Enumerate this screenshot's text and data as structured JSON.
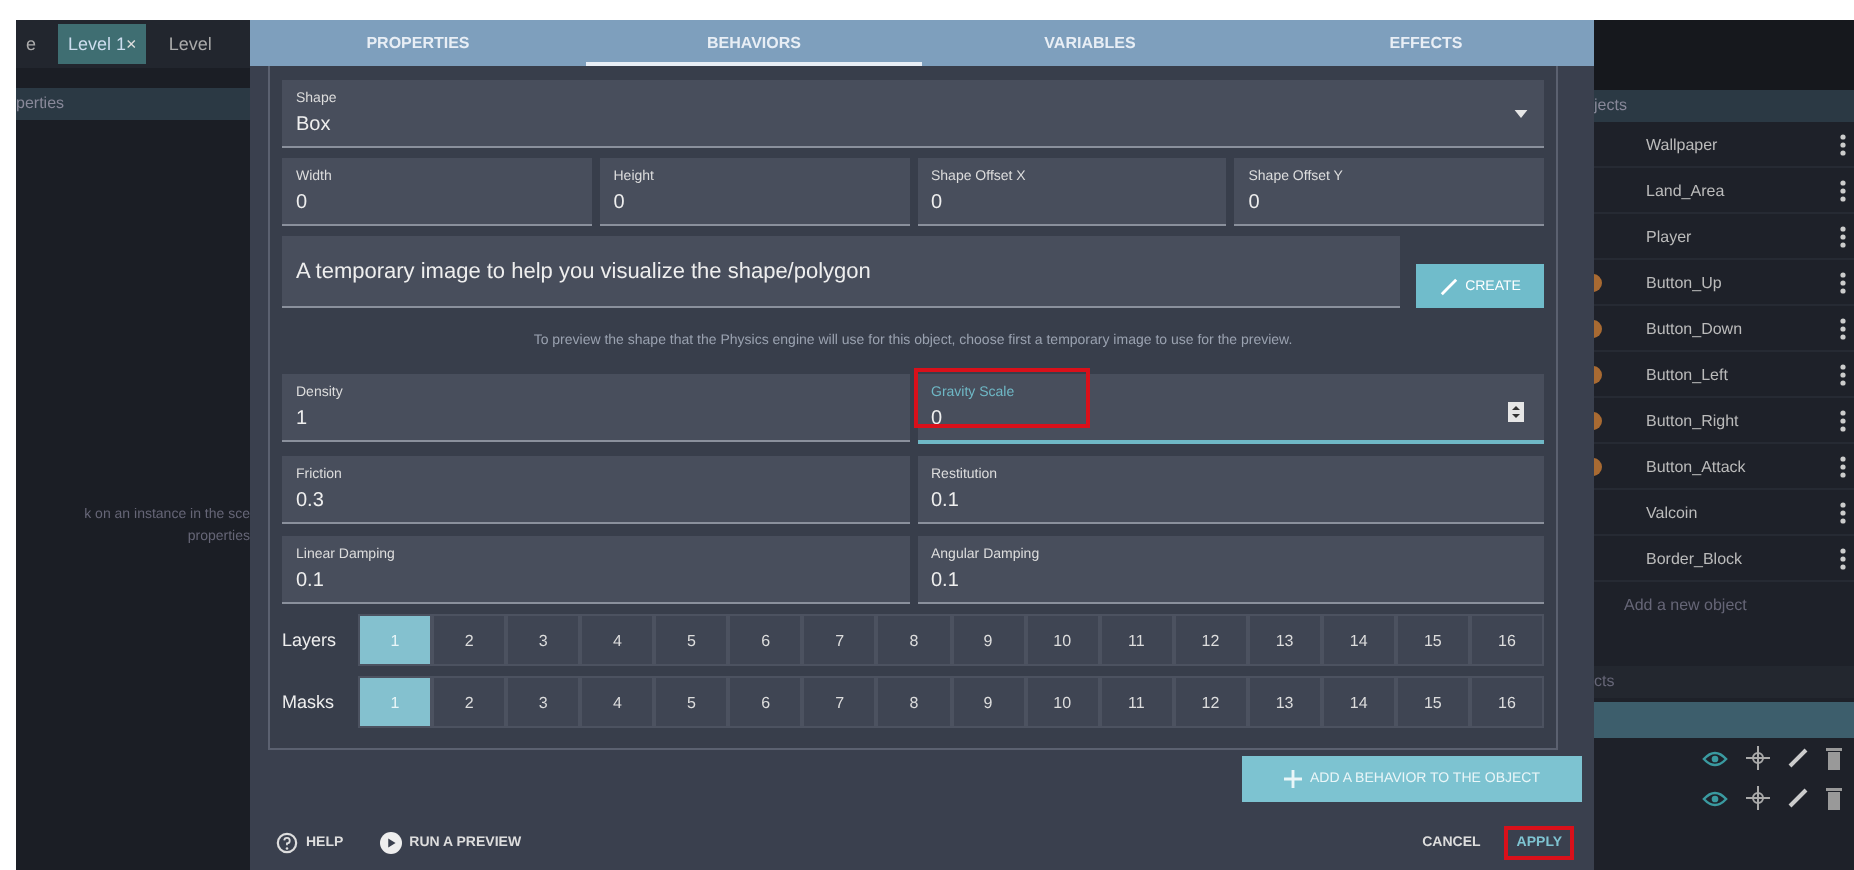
{
  "left_panel": {
    "tabs": [
      {
        "label": "e",
        "selected": false
      },
      {
        "label": "Level 1",
        "close": "×",
        "selected": true
      },
      {
        "label": "Level",
        "selected": false
      }
    ],
    "header": "perties",
    "hint": [
      "k on an instance in the sce",
      "properties"
    ]
  },
  "dialog": {
    "tabs": [
      {
        "label": "PROPERTIES",
        "selected": false
      },
      {
        "label": "BEHAVIORS",
        "selected": true
      },
      {
        "label": "VARIABLES",
        "selected": false
      },
      {
        "label": "EFFECTS",
        "selected": false
      }
    ],
    "shape": {
      "label": "Shape",
      "value": "Box"
    },
    "size_fields": [
      {
        "label": "Width",
        "value": "0"
      },
      {
        "label": "Height",
        "value": "0"
      },
      {
        "label": "Shape Offset X",
        "value": "0"
      },
      {
        "label": "Shape Offset Y",
        "value": "0"
      }
    ],
    "image_field": {
      "value": "A temporary image to help you visualize the shape/polygon"
    },
    "create_button": "CREATE",
    "preview_hint": "To preview the shape that the Physics engine will use for this object, choose first a temporary image to use for the preview.",
    "physics_fields": [
      {
        "label": "Density",
        "value": "1",
        "focused": false,
        "highlighted": false
      },
      {
        "label": "Gravity Scale",
        "value": "0",
        "focused": true,
        "highlighted": true
      },
      {
        "label": "Friction",
        "value": "0.3",
        "focused": false,
        "highlighted": false
      },
      {
        "label": "Restitution",
        "value": "0.1",
        "focused": false,
        "highlighted": false
      },
      {
        "label": "Linear Damping",
        "value": "0.1",
        "focused": false,
        "highlighted": false
      },
      {
        "label": "Angular Damping",
        "value": "0.1",
        "focused": false,
        "highlighted": false
      }
    ],
    "bit_rows": [
      {
        "label": "Layers",
        "bits": [
          {
            "label": "1",
            "selected": true
          },
          {
            "label": "2",
            "selected": false
          },
          {
            "label": "3",
            "selected": false
          },
          {
            "label": "4",
            "selected": false
          },
          {
            "label": "5",
            "selected": false
          },
          {
            "label": "6",
            "selected": false
          },
          {
            "label": "7",
            "selected": false
          },
          {
            "label": "8",
            "selected": false
          },
          {
            "label": "9",
            "selected": false
          },
          {
            "label": "10",
            "selected": false
          },
          {
            "label": "11",
            "selected": false
          },
          {
            "label": "12",
            "selected": false
          },
          {
            "label": "13",
            "selected": false
          },
          {
            "label": "14",
            "selected": false
          },
          {
            "label": "15",
            "selected": false
          },
          {
            "label": "16",
            "selected": false
          }
        ]
      },
      {
        "label": "Masks",
        "bits": [
          {
            "label": "1",
            "selected": true
          },
          {
            "label": "2",
            "selected": false
          },
          {
            "label": "3",
            "selected": false
          },
          {
            "label": "4",
            "selected": false
          },
          {
            "label": "5",
            "selected": false
          },
          {
            "label": "6",
            "selected": false
          },
          {
            "label": "7",
            "selected": false
          },
          {
            "label": "8",
            "selected": false
          },
          {
            "label": "9",
            "selected": false
          },
          {
            "label": "10",
            "selected": false
          },
          {
            "label": "11",
            "selected": false
          },
          {
            "label": "12",
            "selected": false
          },
          {
            "label": "13",
            "selected": false
          },
          {
            "label": "14",
            "selected": false
          },
          {
            "label": "15",
            "selected": false
          },
          {
            "label": "16",
            "selected": false
          }
        ]
      }
    ],
    "add_behavior_button": "ADD A BEHAVIOR TO THE OBJECT",
    "footer": {
      "help": "HELP",
      "preview": "RUN A PREVIEW",
      "cancel": "CANCEL",
      "apply": {
        "label": "APPLY",
        "highlighted": true
      }
    }
  },
  "right_panel": {
    "header": "jects",
    "objects": [
      {
        "name": "Wallpaper",
        "thumbnail": false
      },
      {
        "name": "Land_Area",
        "thumbnail": false
      },
      {
        "name": "Player",
        "thumbnail": false
      },
      {
        "name": "Button_Up",
        "thumbnail": true
      },
      {
        "name": "Button_Down",
        "thumbnail": true
      },
      {
        "name": "Button_Left",
        "thumbnail": true
      },
      {
        "name": "Button_Right",
        "thumbnail": true
      },
      {
        "name": "Button_Attack",
        "thumbnail": true
      },
      {
        "name": "Valcoin",
        "thumbnail": false
      },
      {
        "name": "Border_Block",
        "thumbnail": false
      }
    ],
    "add_object": "Add a new object",
    "layers_header": "cts"
  }
}
